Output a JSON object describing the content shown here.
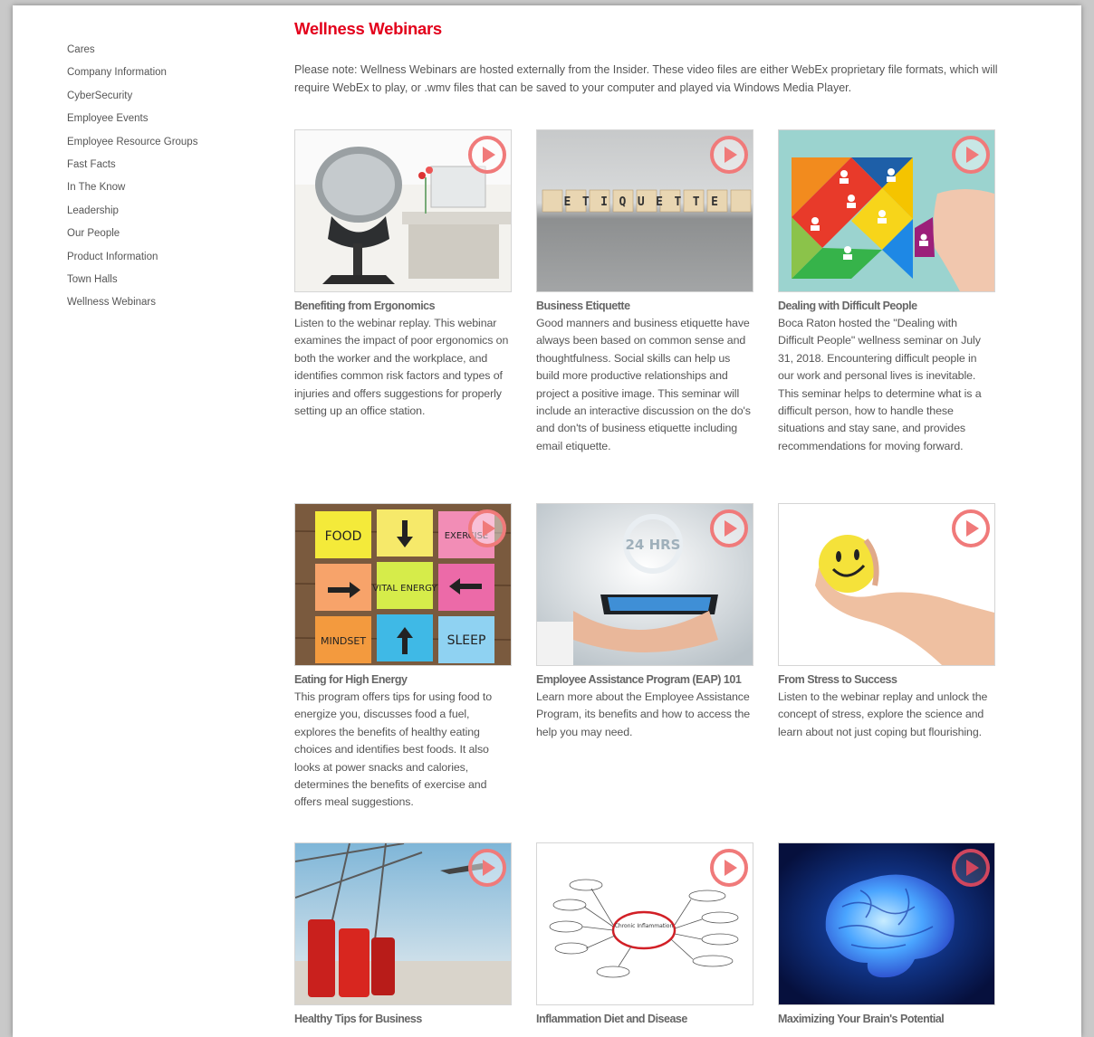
{
  "colors": {
    "accent": "#e3001b",
    "play": "#f26b6b"
  },
  "sidebar": {
    "items": [
      {
        "label": "Cares"
      },
      {
        "label": "Company Information"
      },
      {
        "label": "CyberSecurity"
      },
      {
        "label": "Employee Events"
      },
      {
        "label": "Employee Resource Groups"
      },
      {
        "label": "Fast Facts"
      },
      {
        "label": "In The Know"
      },
      {
        "label": "Leadership"
      },
      {
        "label": "Our People"
      },
      {
        "label": "Product Information"
      },
      {
        "label": "Town Halls"
      },
      {
        "label": "Wellness Webinars"
      }
    ]
  },
  "main": {
    "title": "Wellness Webinars",
    "note": "Please note: Wellness Webinars are hosted externally from the Insider. These video files are either WebEx proprietary file formats, which will require WebEx to play, or .wmv files that can be saved to your computer and played via Windows Media Player."
  },
  "webinars": [
    {
      "title": "Benefiting from Ergonomics",
      "desc": "Listen to the webinar replay. This webinar examines the impact of poor ergonomics on both the worker and the workplace, and identifies common risk factors and types of injuries and offers suggestions for properly setting up an office station.",
      "image": "office-chair-photo"
    },
    {
      "title": "Business Etiquette",
      "desc": "Good manners and business etiquette have always been based on common sense and thoughtfulness. Social skills can help us build more productive relationships and project a positive image. This seminar will include an interactive discussion on the do's and don'ts of business etiquette including email etiquette.",
      "image": "etiquette-blocks-photo",
      "image_text": "ETIQUETTE"
    },
    {
      "title": "Dealing with Difficult People",
      "desc": "Boca Raton hosted the \"Dealing with Difficult People\" wellness seminar on July 31, 2018. Encountering difficult people in our work and personal lives is inevitable. This seminar helps to determine what is a difficult person, how to handle these situations and stay sane, and provides recommendations for moving forward.",
      "image": "tangram-puzzle-photo"
    },
    {
      "title": "Eating for High Energy",
      "desc": "This program offers tips for using food to energize you, discusses food a fuel, explores the benefits of healthy eating choices and identifies best foods. It also looks at power snacks and calories, determines the benefits of exercise and offers meal suggestions.",
      "image": "sticky-notes-photo",
      "image_notes": [
        "FOOD",
        "EXERCISE",
        "VITAL ENERGY",
        "MINDSET",
        "SLEEP"
      ]
    },
    {
      "title": "Employee Assistance Program (EAP) 101",
      "desc": "Learn more about the Employee Assistance Program, its benefits and how to access the help you may need.",
      "image": "phone-in-hand-photo",
      "image_text": "24 HRS"
    },
    {
      "title": "From Stress to Success",
      "desc": "Listen to the webinar replay and unlock the concept of stress, explore the science and learn about not just coping but flourishing.",
      "image": "stress-ball-photo"
    },
    {
      "title": "Healthy Tips for Business",
      "desc": "",
      "image": "luggage-airport-photo"
    },
    {
      "title": "Inflammation Diet and Disease",
      "desc": "",
      "image": "inflammation-diagram",
      "image_text": "Chronic Inflammation"
    },
    {
      "title": "Maximizing Your Brain's Potential",
      "desc": "",
      "image": "brain-illustration"
    }
  ]
}
